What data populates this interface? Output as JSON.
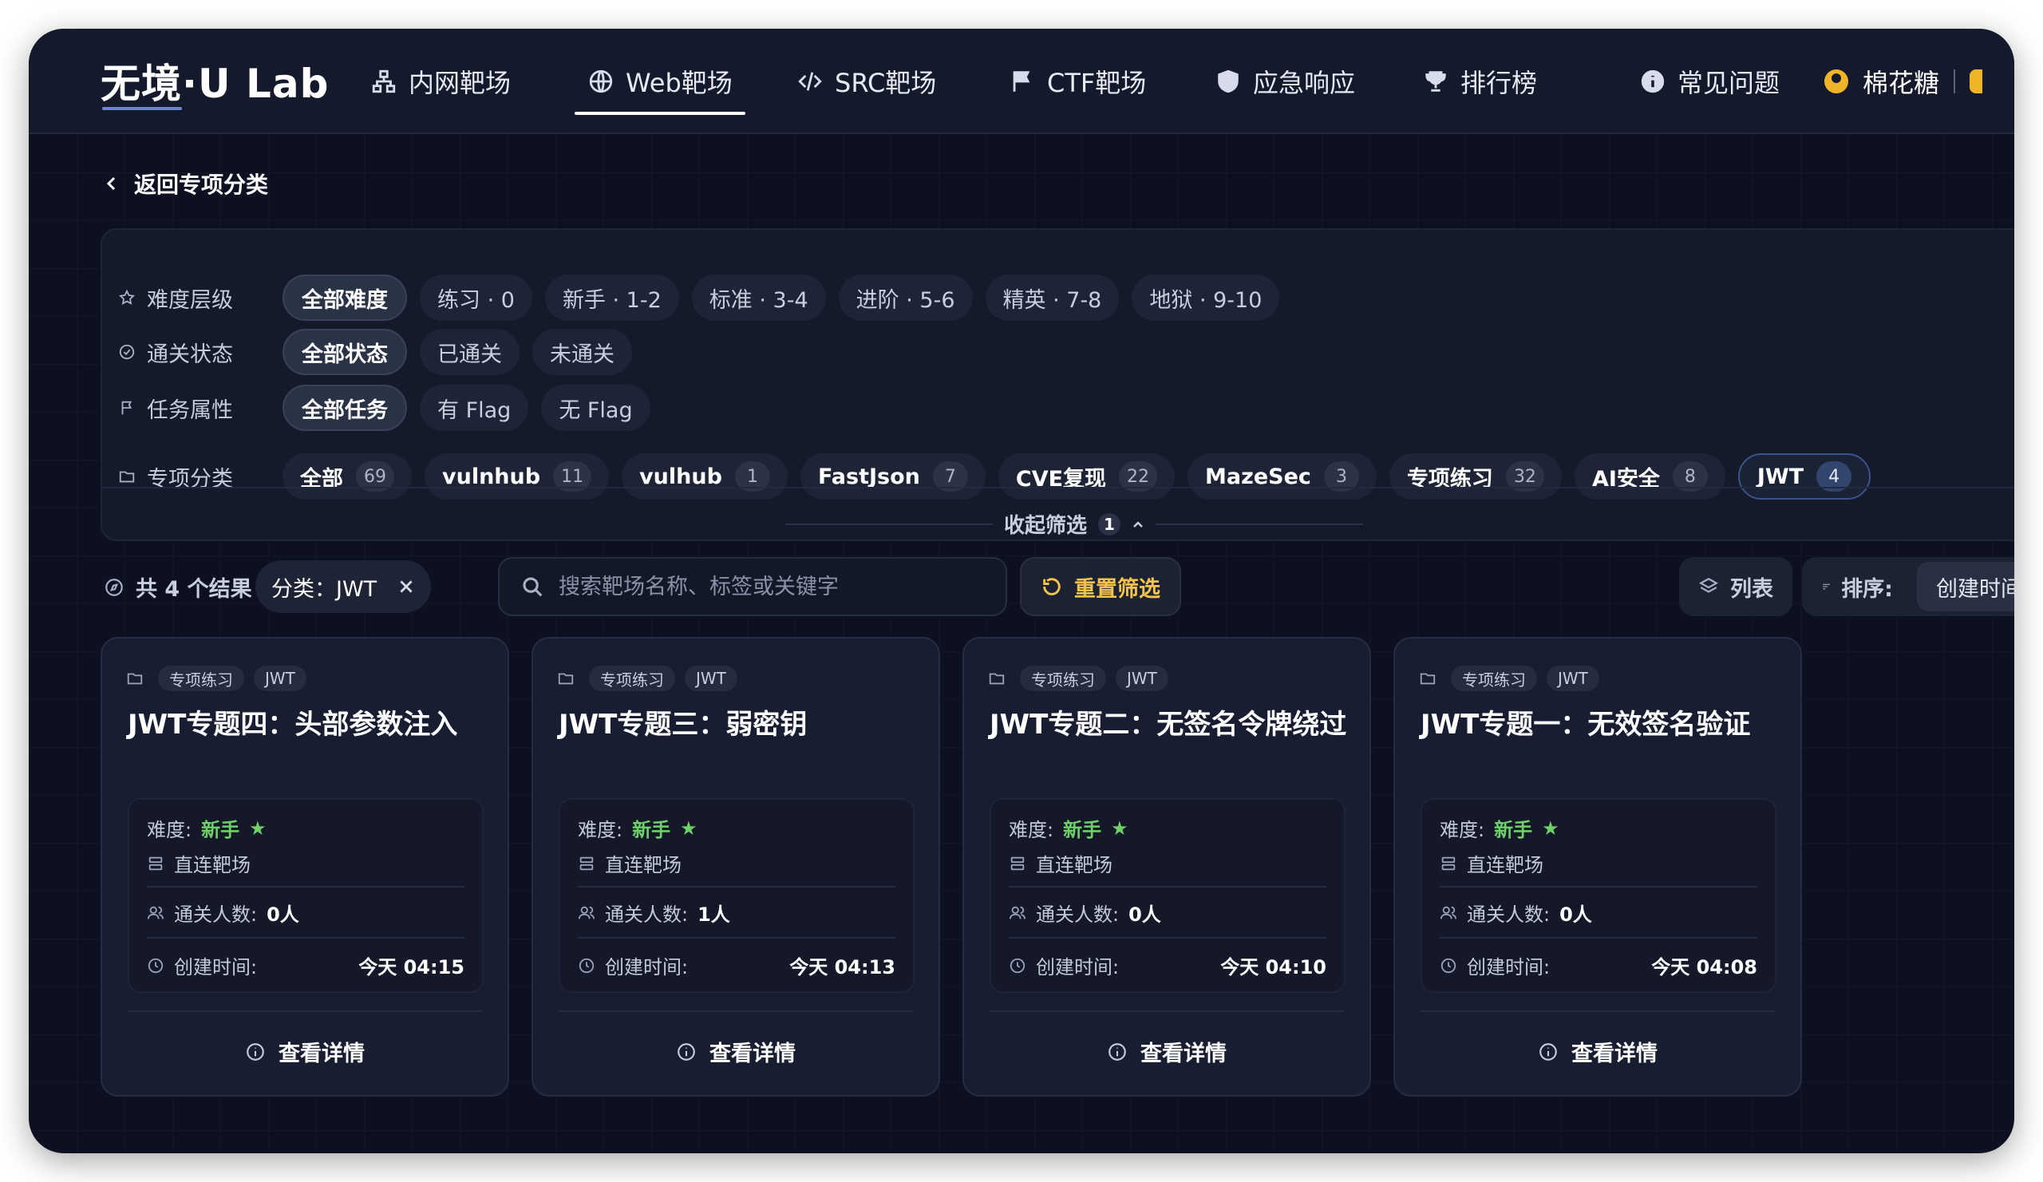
{
  "app": {
    "logo": "无境·U Lab"
  },
  "nav": {
    "items": [
      {
        "label": "内网靶场",
        "icon": "network-icon"
      },
      {
        "label": "Web靶场",
        "icon": "globe-icon",
        "active": true
      },
      {
        "label": "SRC靶场",
        "icon": "code-icon"
      },
      {
        "label": "CTF靶场",
        "icon": "flag-icon"
      },
      {
        "label": "应急响应",
        "icon": "shield-icon"
      },
      {
        "label": "排行榜",
        "icon": "trophy-icon"
      },
      {
        "label": "常见问题",
        "icon": "info-icon"
      }
    ],
    "user": {
      "name": "棉花糖"
    }
  },
  "back": {
    "label": "返回专项分类"
  },
  "filters": {
    "difficulty": {
      "label": "难度层级",
      "options": [
        "全部难度",
        "练习 · 0",
        "新手 · 1-2",
        "标准 · 3-4",
        "进阶 · 5-6",
        "精英 · 7-8",
        "地狱 · 9-10"
      ],
      "selected": "全部难度"
    },
    "status": {
      "label": "通关状态",
      "options": [
        "全部状态",
        "已通关",
        "未通关"
      ],
      "selected": "全部状态"
    },
    "attribute": {
      "label": "任务属性",
      "options": [
        "全部任务",
        "有 Flag",
        "无 Flag"
      ],
      "selected": "全部任务"
    },
    "category": {
      "label": "专项分类",
      "options": [
        {
          "label": "全部",
          "count": "69"
        },
        {
          "label": "vulnhub",
          "count": "11"
        },
        {
          "label": "vulhub",
          "count": "1"
        },
        {
          "label": "FastJson",
          "count": "7"
        },
        {
          "label": "CVE复现",
          "count": "22"
        },
        {
          "label": "MazeSec",
          "count": "3"
        },
        {
          "label": "专项练习",
          "count": "32"
        },
        {
          "label": "AI安全",
          "count": "8"
        },
        {
          "label": "JWT",
          "count": "4"
        }
      ],
      "selected": "JWT"
    },
    "collapse_label": "收起筛选",
    "active_count": "1"
  },
  "toolbar": {
    "result_text": "共 4 个结果",
    "category_tag": "分类：JWT",
    "search_placeholder": "搜索靶场名称、标签或关键字",
    "search_value": "",
    "reset_label": "重置筛选",
    "view_label": "列表",
    "sort_label": "排序:",
    "sort_value": "创建时间"
  },
  "cards": [
    {
      "tags": [
        "专项练习",
        "JWT"
      ],
      "title": "JWT专题四：头部参数注入",
      "difficulty_label": "难度:",
      "difficulty": "新手",
      "type": "直连靶场",
      "solvers_label": "通关人数:",
      "solvers": "0人",
      "created_label": "创建时间:",
      "created": "今天 04:15",
      "detail_label": "查看详情"
    },
    {
      "tags": [
        "专项练习",
        "JWT"
      ],
      "title": "JWT专题三：弱密钥",
      "difficulty_label": "难度:",
      "difficulty": "新手",
      "type": "直连靶场",
      "solvers_label": "通关人数:",
      "solvers": "1人",
      "created_label": "创建时间:",
      "created": "今天 04:13",
      "detail_label": "查看详情"
    },
    {
      "tags": [
        "专项练习",
        "JWT"
      ],
      "title": "JWT专题二：无签名令牌绕过",
      "difficulty_label": "难度:",
      "difficulty": "新手",
      "type": "直连靶场",
      "solvers_label": "通关人数:",
      "solvers": "0人",
      "created_label": "创建时间:",
      "created": "今天 04:10",
      "detail_label": "查看详情"
    },
    {
      "tags": [
        "专项练习",
        "JWT"
      ],
      "title": "JWT专题一：无效签名验证",
      "difficulty_label": "难度:",
      "difficulty": "新手",
      "type": "直连靶场",
      "solvers_label": "通关人数:",
      "solvers": "0人",
      "created_label": "创建时间:",
      "created": "今天 04:08",
      "detail_label": "查看详情"
    }
  ],
  "colors": {
    "background": "#0d1020",
    "panel": "#151a2b",
    "accent_yellow": "#f3c34c",
    "difficulty_green": "#6fcf6a",
    "active_category_border": "#3a5389"
  }
}
